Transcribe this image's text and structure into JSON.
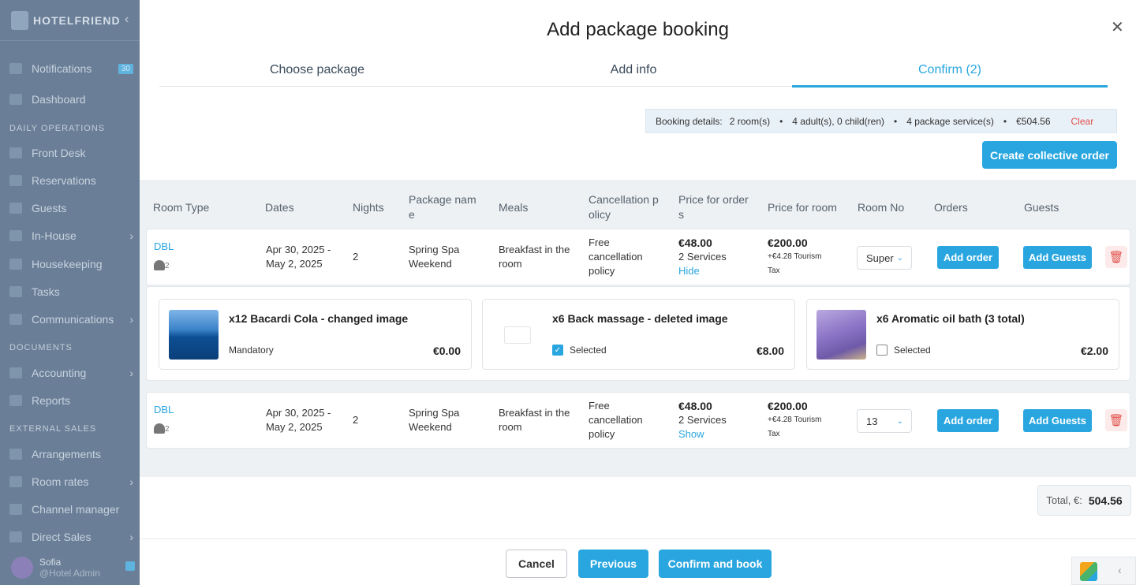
{
  "sidebar": {
    "brand": "HOTELFRIEND",
    "collapse_icon": "‹",
    "items": [
      {
        "label": "Notifications",
        "badge": "30"
      },
      {
        "label": "Dashboard"
      },
      {
        "label": "Front Desk"
      },
      {
        "label": "Reservations"
      },
      {
        "label": "Guests"
      },
      {
        "label": "In-House"
      },
      {
        "label": "Housekeeping"
      },
      {
        "label": "Tasks"
      },
      {
        "label": "Communications"
      },
      {
        "label": "Accounting"
      },
      {
        "label": "Reports"
      },
      {
        "label": "Arrangements"
      },
      {
        "label": "Room rates"
      },
      {
        "label": "Channel manager"
      },
      {
        "label": "Direct Sales"
      }
    ],
    "sections": [
      "DAILY OPERATIONS",
      "DOCUMENTS",
      "EXTERNAL SALES"
    ],
    "user": {
      "name": "Sofia",
      "role": "@Hotel Admin"
    }
  },
  "modal": {
    "title": "Add package booking",
    "close_icon": "✕",
    "tabs": [
      "Choose package",
      "Add info",
      "Confirm (2)"
    ],
    "active_tab": 2
  },
  "booking_details": {
    "label": "Booking details:",
    "rooms": "2 room(s)",
    "guests": "4 adult(s), 0 child(ren)",
    "services": "4 package service(s)",
    "price": "€504.56",
    "clear": "Clear"
  },
  "create_collective_order": "Create collective order",
  "table": {
    "headers": {
      "room_type": "Room Type",
      "dates": "Dates",
      "nights": "Nights",
      "package_name_1": "Package nam",
      "package_name_2": "e",
      "meals": "Meals",
      "cancel_1": "Cancellation p",
      "cancel_2": "olicy",
      "price_orders_1": "Price for order",
      "price_orders_2": "s",
      "price_room": "Price for room",
      "room_no": "Room No",
      "orders": "Orders",
      "guests": "Guests"
    },
    "rows": [
      {
        "room_type": "DBL",
        "guest_count": "2",
        "date_1": "Apr 30, 2025 -",
        "date_2": "May 2, 2025",
        "nights": "2",
        "package_1": "Spring Spa",
        "package_2": "Weekend",
        "meals_1": "Breakfast in the",
        "meals_2": "room",
        "cancel_1": "Free",
        "cancel_2": "cancellation",
        "cancel_3": "policy",
        "order_price": "€48.00",
        "order_services": "2 Services",
        "toggle": "Hide",
        "room_price": "€200.00",
        "tax_1": "+€4.28 Tourism",
        "tax_2": "Tax",
        "room_no": "Super",
        "add_order": "Add order",
        "add_guests": "Add Guests"
      },
      {
        "room_type": "DBL",
        "guest_count": "2",
        "date_1": "Apr 30, 2025 -",
        "date_2": "May 2, 2025",
        "nights": "2",
        "package_1": "Spring Spa",
        "package_2": "Weekend",
        "meals_1": "Breakfast in the",
        "meals_2": "room",
        "cancel_1": "Free",
        "cancel_2": "cancellation",
        "cancel_3": "policy",
        "order_price": "€48.00",
        "order_services": "2 Services",
        "toggle": "Show",
        "room_price": "€200.00",
        "tax_1": "+€4.28 Tourism",
        "tax_2": "Tax",
        "room_no": "13",
        "add_order": "Add order",
        "add_guests": "Add Guests"
      }
    ]
  },
  "services": [
    {
      "title": "x12 Bacardi Cola - changed image",
      "sub": "Mandatory",
      "price": "€0.00",
      "checked": null
    },
    {
      "title": "x6 Back massage - deleted image",
      "sub": "Selected",
      "price": "€8.00",
      "checked": true
    },
    {
      "title": "x6 Aromatic oil bath (3 total)",
      "sub": "Selected",
      "price": "€2.00",
      "checked": false
    }
  ],
  "total": {
    "label": "Total, €:",
    "value": "504.56"
  },
  "footer": {
    "cancel": "Cancel",
    "previous": "Previous",
    "confirm": "Confirm and book"
  },
  "colors": {
    "accent": "#29a6df",
    "danger": "#e0504a",
    "sidebar": "#6a7f97"
  }
}
